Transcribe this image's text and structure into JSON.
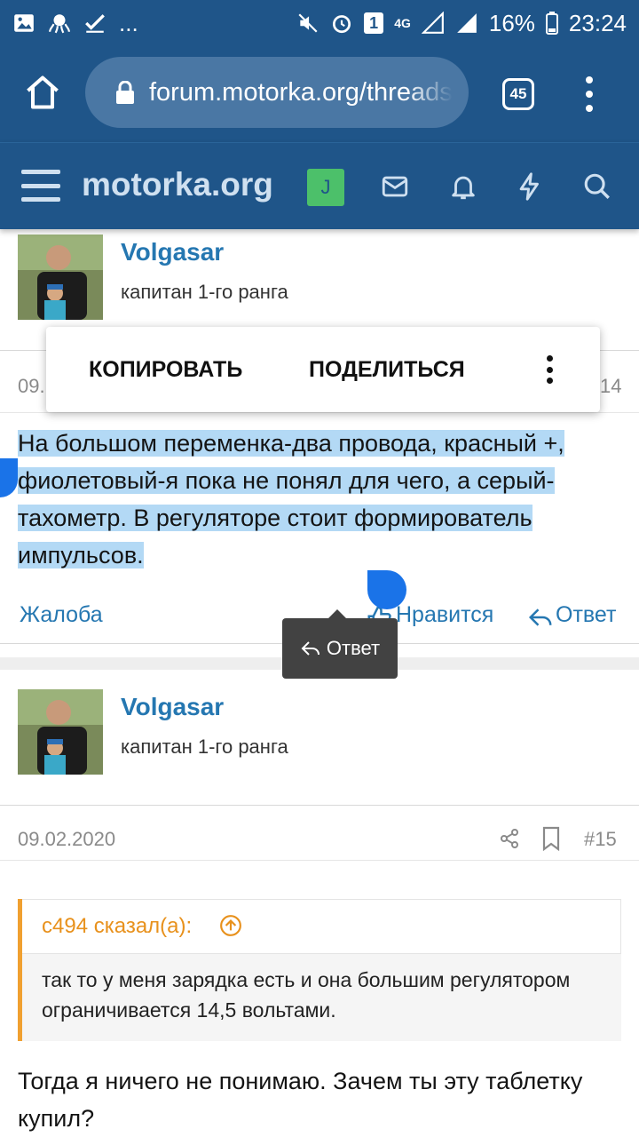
{
  "status_bar": {
    "notification_icons": [
      "image-icon",
      "octopus-icon",
      "check-icon",
      "more-dots"
    ],
    "more": "...",
    "sim_badge": "1",
    "network": "4G",
    "battery_percent": "16%",
    "time": "23:24"
  },
  "browser": {
    "url": "forum.motorka.org/threads",
    "tab_count": "45"
  },
  "site": {
    "title": "motorka.org",
    "user_initial": "J"
  },
  "context_menu": {
    "copy": "КОПИРОВАТЬ",
    "share": "ПОДЕЛИТЬСЯ"
  },
  "post1": {
    "author": "Volgasar",
    "rank": "капитан 1-го ранга",
    "date_visible": "09.",
    "number_visible": "14",
    "body": "На большом переменка-два провода, красный +, фиолетовый-я пока не понял для чего, а серый-тахометр. В регуляторе стоит формирователь импульсов.",
    "report": "Жалоба",
    "like": "Нравится",
    "reply": "Ответ"
  },
  "tooltip": {
    "label": "Ответ"
  },
  "post2": {
    "author": "Volgasar",
    "rank": "капитан 1-го ранга",
    "date": "09.02.2020",
    "number": "#15",
    "quote_author": "с494 сказал(а):",
    "quote_text": "так то у меня зарядка есть и она большим регулятором ограничивается 14,5 вольтами.",
    "body": "Тогда я ничего не понимаю. Зачем ты эту таблетку купил?"
  }
}
